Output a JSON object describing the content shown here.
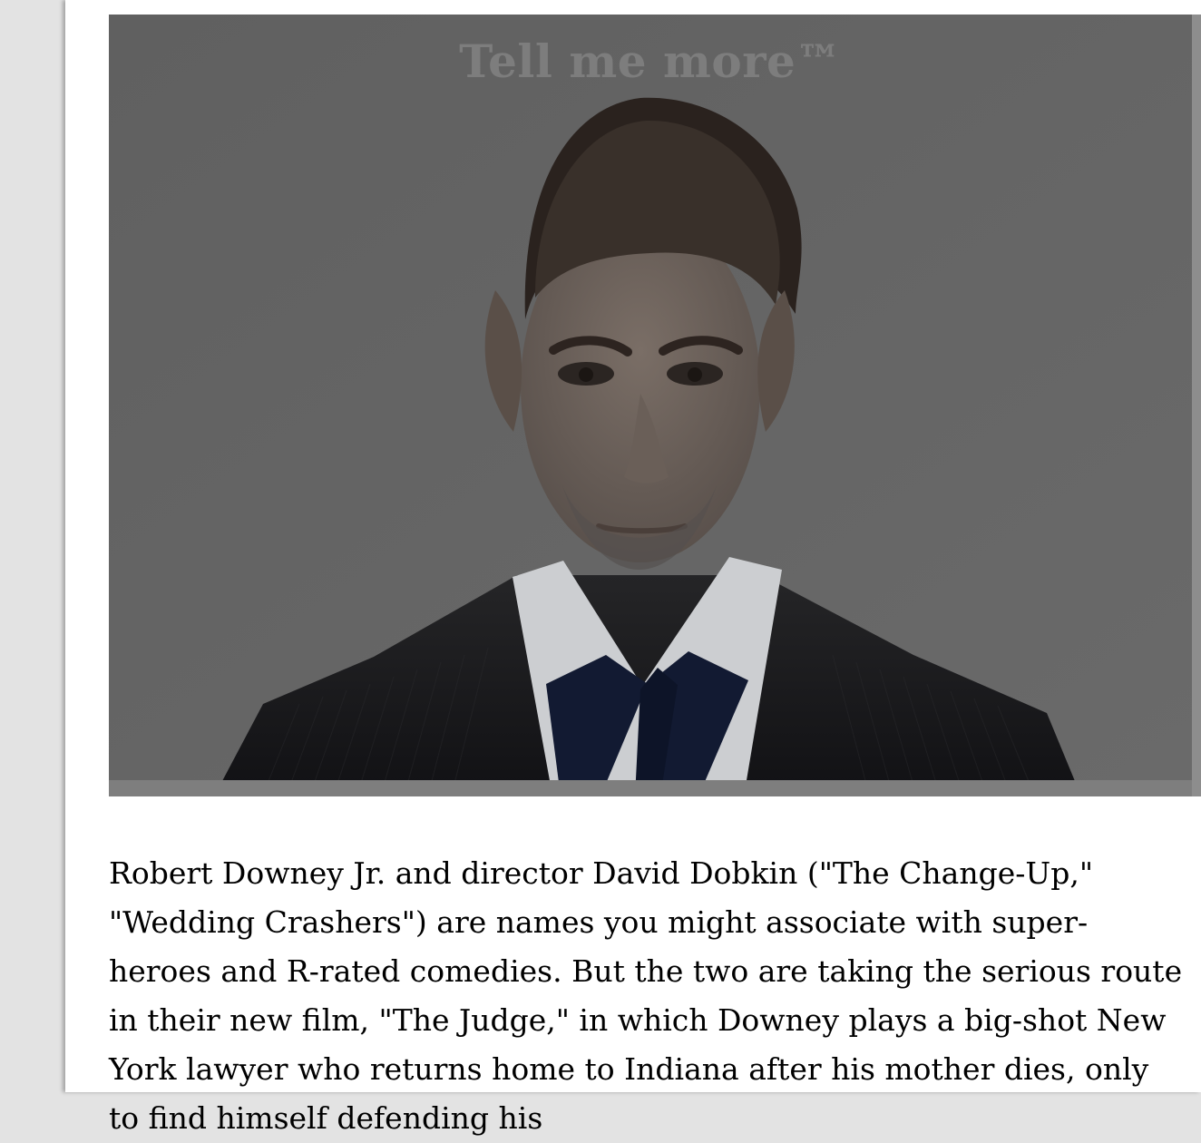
{
  "hero": {
    "title": "Tell me more™",
    "image_label": "portrait photo"
  },
  "article": {
    "paragraph_1": "Robert Downey Jr. and director David Dobkin (\"The Change-Up,\" \"Wedding Crashers\") are names you might associate with super-heroes and R-rated comedies.  But the two are taking the serious route in their new film, \"The Judge,\" in which Downey plays a big-shot New York lawyer who returns home to Indiana after his mother dies, only to find himself defending his"
  },
  "colors": {
    "page_bg": "#e3e3e3",
    "card_bg": "#ffffff",
    "hero_overlay": "#646464",
    "hero_title": "#7d7d7d",
    "text": "#000000"
  }
}
